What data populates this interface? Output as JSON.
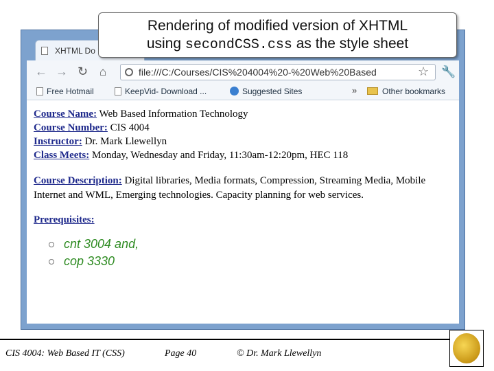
{
  "callout": {
    "line1": "Rendering of modified version of XHTML",
    "line2_pre": "using ",
    "line2_code": "secondCSS.css",
    "line2_post": " as the style sheet"
  },
  "browser": {
    "tab_title": "XHTML Do",
    "url": "file:///C:/Courses/CIS%204004%20-%20Web%20Based",
    "bookmarks": [
      "Free Hotmail",
      "KeepVid- Download ...",
      "Suggested Sites"
    ],
    "chevron": "»",
    "other_bookmarks": "Other bookmarks"
  },
  "page": {
    "course_name_label": "Course Name:",
    "course_name": " Web Based Information Technology",
    "course_number_label": "Course Number:",
    "course_number": " CIS 4004",
    "instructor_label": "Instructor:",
    "instructor": " Dr. Mark Llewellyn",
    "meets_label": "Class Meets:",
    "meets": " Monday, Wednesday and Friday, 11:30am-12:20pm, HEC 118",
    "desc_label": "Course Description:",
    "desc": " Digital libraries, Media formats, Compression, Streaming Media, Mobile Internet and WML, Emerging technologies. Capacity planning for web services.",
    "prereq_label": "Prerequisites:",
    "prereqs": [
      "cnt 3004 and,",
      "cop 3330"
    ]
  },
  "footer": {
    "course": "CIS 4004: Web Based IT (CSS)",
    "page": "Page 40",
    "author": "© Dr. Mark Llewellyn"
  }
}
